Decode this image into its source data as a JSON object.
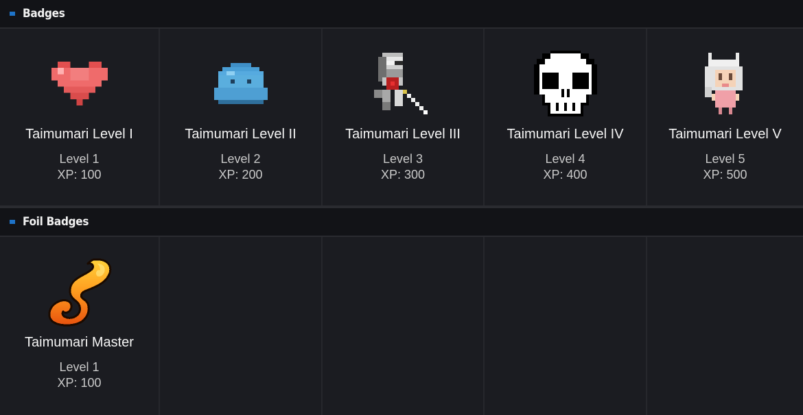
{
  "sections": [
    {
      "title": "Badges",
      "badges": [
        {
          "name": "Taimumari Level I",
          "level": "Level 1",
          "xp": "XP: 100",
          "icon": "heart-icon"
        },
        {
          "name": "Taimumari Level II",
          "level": "Level 2",
          "xp": "XP: 200",
          "icon": "slime-icon"
        },
        {
          "name": "Taimumari Level III",
          "level": "Level 3",
          "xp": "XP: 300",
          "icon": "skeleton-knight-icon"
        },
        {
          "name": "Taimumari Level IV",
          "level": "Level 4",
          "xp": "XP: 400",
          "icon": "skull-icon"
        },
        {
          "name": "Taimumari Level V",
          "level": "Level 5",
          "xp": "XP: 500",
          "icon": "girl-sprite-icon"
        }
      ]
    },
    {
      "title": "Foil Badges",
      "badges": [
        {
          "name": "Taimumari Master",
          "level": "Level 1",
          "xp": "XP: 100",
          "icon": "flame-s-icon"
        }
      ]
    }
  ],
  "colors": {
    "accent": "#1e73c8",
    "background": "#1b1c21",
    "header_background": "#121317"
  }
}
